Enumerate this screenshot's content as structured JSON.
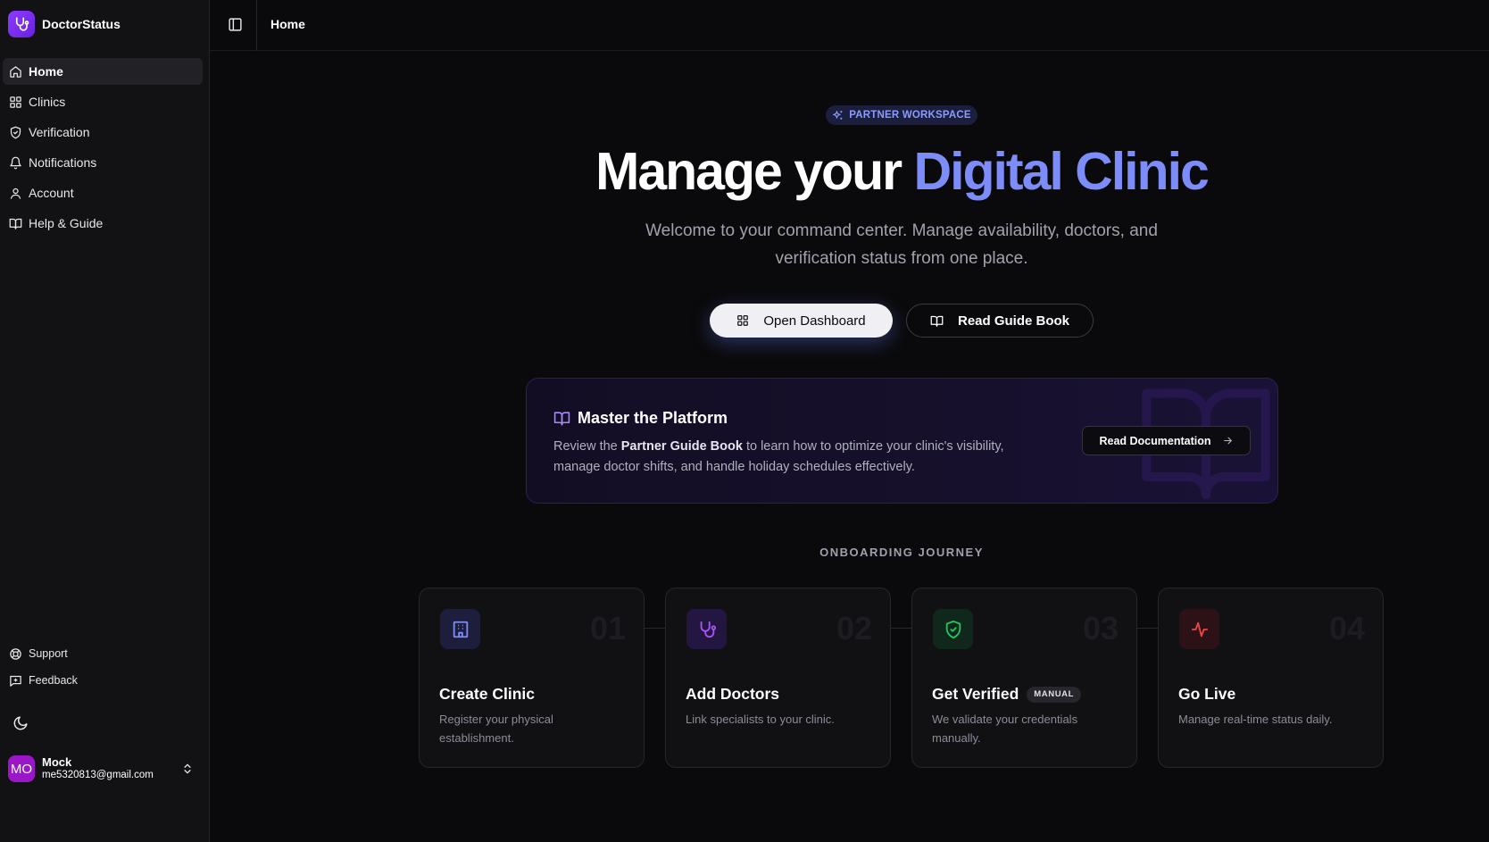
{
  "app": {
    "name": "DoctorStatus"
  },
  "sidebar": {
    "items": [
      {
        "label": "Home",
        "icon": "home-icon",
        "active": true
      },
      {
        "label": "Clinics",
        "icon": "grid-icon"
      },
      {
        "label": "Verification",
        "icon": "shield-check-icon"
      },
      {
        "label": "Notifications",
        "icon": "bell-icon"
      },
      {
        "label": "Account",
        "icon": "user-icon"
      },
      {
        "label": "Help & Guide",
        "icon": "book-open-icon"
      }
    ],
    "bottom_items": [
      {
        "label": "Support",
        "icon": "lifebuoy-icon"
      },
      {
        "label": "Feedback",
        "icon": "message-plus-icon"
      }
    ],
    "theme_icon": "moon-icon",
    "user": {
      "initials": "MO",
      "name": "Mock",
      "email": "me5320813@gmail.com"
    }
  },
  "topbar": {
    "title": "Home"
  },
  "hero": {
    "badge": "PARTNER WORKSPACE",
    "title_plain": "Manage your ",
    "title_accent": "Digital Clinic",
    "subtitle": "Welcome to your command center. Manage availability, doctors, and verification status from one place.",
    "primary_button": "Open Dashboard",
    "secondary_button": "Read Guide Book"
  },
  "master_card": {
    "title": "Master the Platform",
    "text_before": "Review the ",
    "text_bold": "Partner Guide Book",
    "text_after": " to learn how to optimize your clinic's visibility, manage doctor shifts, and handle holiday schedules effectively.",
    "button": "Read Documentation"
  },
  "journey": {
    "label": "ONBOARDING JOURNEY",
    "steps": [
      {
        "num": "01",
        "title": "Create Clinic",
        "desc": "Register your physical establishment.",
        "icon": "building-icon",
        "color": "#7c8cf8"
      },
      {
        "num": "02",
        "title": "Add Doctors",
        "desc": "Link specialists to your clinic.",
        "icon": "stethoscope-icon",
        "color": "#a855f7"
      },
      {
        "num": "03",
        "title": "Get Verified",
        "tag": "MANUAL",
        "desc": "We validate your credentials manually.",
        "icon": "shield-check-icon",
        "color": "#22c55e"
      },
      {
        "num": "04",
        "title": "Go Live",
        "desc": "Manage real-time status daily.",
        "icon": "activity-icon",
        "color": "#ef4444"
      }
    ]
  },
  "colors": {
    "accent": "#7c8cf8",
    "brand": "#8b3dff",
    "avatar": "#9b16c8"
  }
}
